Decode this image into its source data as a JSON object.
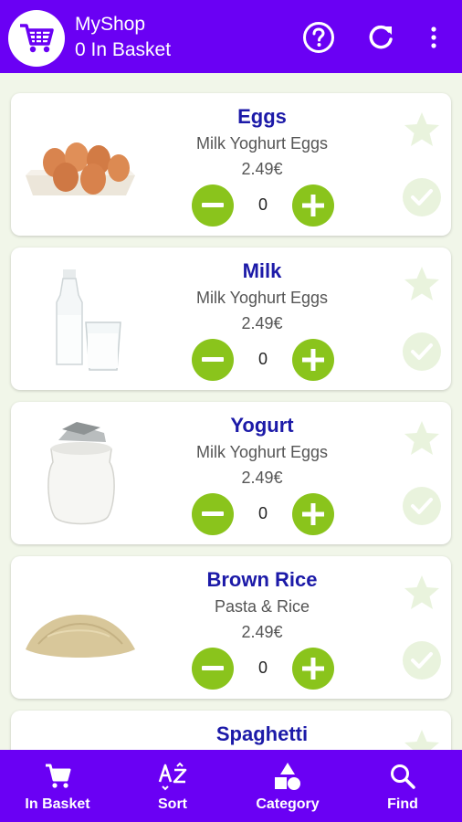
{
  "app": {
    "title": "MyShop",
    "basket_status": "0 In Basket",
    "accent_color": "#6a00f4",
    "button_color": "#8ac41c"
  },
  "actions": {
    "help_icon": "help-circle-icon",
    "refresh_icon": "refresh-icon",
    "menu_icon": "more-vert-icon"
  },
  "products": [
    {
      "name": "Eggs",
      "category": "Milk Yoghurt Eggs",
      "price": "2.49€",
      "qty": "0",
      "image": "eggs-image"
    },
    {
      "name": "Milk",
      "category": "Milk Yoghurt Eggs",
      "price": "2.49€",
      "qty": "0",
      "image": "milk-image"
    },
    {
      "name": "Yogurt",
      "category": "Milk Yoghurt Eggs",
      "price": "2.49€",
      "qty": "0",
      "image": "yogurt-image"
    },
    {
      "name": "Brown Rice",
      "category": "Pasta & Rice",
      "price": "2.49€",
      "qty": "0",
      "image": "rice-image"
    },
    {
      "name": "Spaghetti"
    }
  ],
  "bottom_nav": [
    {
      "label": "In Basket",
      "icon": "cart-icon"
    },
    {
      "label": "Sort",
      "icon": "sort-az-icon"
    },
    {
      "label": "Category",
      "icon": "category-icon"
    },
    {
      "label": "Find",
      "icon": "search-icon"
    }
  ]
}
